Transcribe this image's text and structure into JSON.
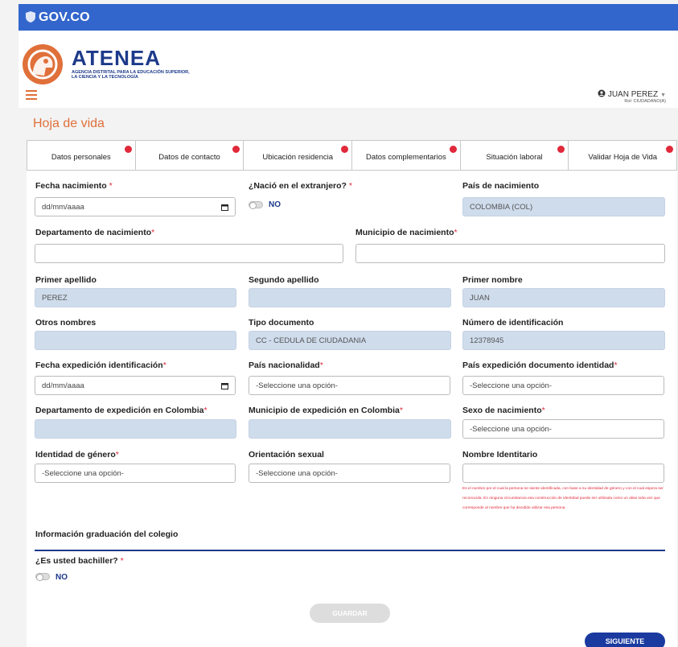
{
  "gov": {
    "label": "GOV.CO"
  },
  "brand": {
    "title": "ATENEA",
    "subtitle": "AGENCIA DISTRITAL PARA LA EDUCACIÓN SUPERIOR, LA CIENCIA Y LA TECNOLOGÍA"
  },
  "user": {
    "name": "JUAN PEREZ",
    "role": "Rol: CIUDADANO(A)"
  },
  "page": {
    "title": "Hoja de vida"
  },
  "tabs": [
    {
      "label": "Datos personales"
    },
    {
      "label": "Datos de contacto"
    },
    {
      "label": "Ubicación residencia"
    },
    {
      "label": "Datos complementarios"
    },
    {
      "label": "Situación laboral"
    },
    {
      "label": "Validar Hoja de Vida"
    }
  ],
  "form": {
    "fecha_nacimiento": {
      "label": "Fecha nacimiento",
      "value": "dd/mm/aaaa"
    },
    "extranjero": {
      "label": "¿Nació en el extranjero?",
      "value": "NO"
    },
    "pais_nacimiento": {
      "label": "País de nacimiento",
      "value": "COLOMBIA (COL)"
    },
    "depto_nacimiento": {
      "label": "Departamento de nacimiento",
      "value": ""
    },
    "municipio_nacimiento": {
      "label": "Municipio de nacimiento",
      "value": ""
    },
    "primer_apellido": {
      "label": "Primer apellido",
      "value": "PEREZ"
    },
    "segundo_apellido": {
      "label": "Segundo apellido",
      "value": ""
    },
    "primer_nombre": {
      "label": "Primer nombre",
      "value": "JUAN"
    },
    "otros_nombres": {
      "label": "Otros nombres",
      "value": ""
    },
    "tipo_documento": {
      "label": "Tipo documento",
      "value": "CC - CEDULA DE CIUDADANIA"
    },
    "numero_identificacion": {
      "label": "Número de identificación",
      "value": "12378945"
    },
    "fecha_expedicion": {
      "label": "Fecha expedición identificación",
      "value": "dd/mm/aaaa"
    },
    "pais_nacionalidad": {
      "label": "País nacionalidad",
      "value": "-Seleccione una opción-"
    },
    "pais_expedicion": {
      "label": "País expedición documento identidad",
      "value": "-Seleccione una opción-"
    },
    "depto_expedicion": {
      "label": "Departamento de expedición en Colombia",
      "value": ""
    },
    "municipio_expedicion": {
      "label": "Municipio de expedición en Colombia",
      "value": ""
    },
    "sexo_nacimiento": {
      "label": "Sexo de nacimiento",
      "value": "-Seleccione una opción-"
    },
    "identidad_genero": {
      "label": "Identidad de género",
      "value": "-Seleccione una opción-"
    },
    "orientacion_sexual": {
      "label": "Orientación sexual",
      "value": "-Seleccione una opción-"
    },
    "nombre_identitario": {
      "label": "Nombre Identitario",
      "value": "",
      "hint": "Es el nombre por el cual la persona se siente identificada, con base a su identidad de género y con el cual espera ser reconocida. En ninguna circunstancia esa construcción de identidad puede ser utilizada como un alias toda vez que corresponde al nombre que ha decidido utilizar esa persona."
    },
    "graduacion_title": "Información graduación del colegio",
    "bachiller": {
      "label": "¿Es usted bachiller?",
      "value": "NO"
    }
  },
  "buttons": {
    "save": "GUARDAR",
    "next": "SIGUIENTE"
  },
  "required_mark": "*",
  "colors": {
    "gov_blue": "#3366cc",
    "brand_orange": "#e0703a",
    "brand_navy": "#1d3a8a",
    "required_red": "#e0293a",
    "readonly_bg": "#cfdcec"
  }
}
